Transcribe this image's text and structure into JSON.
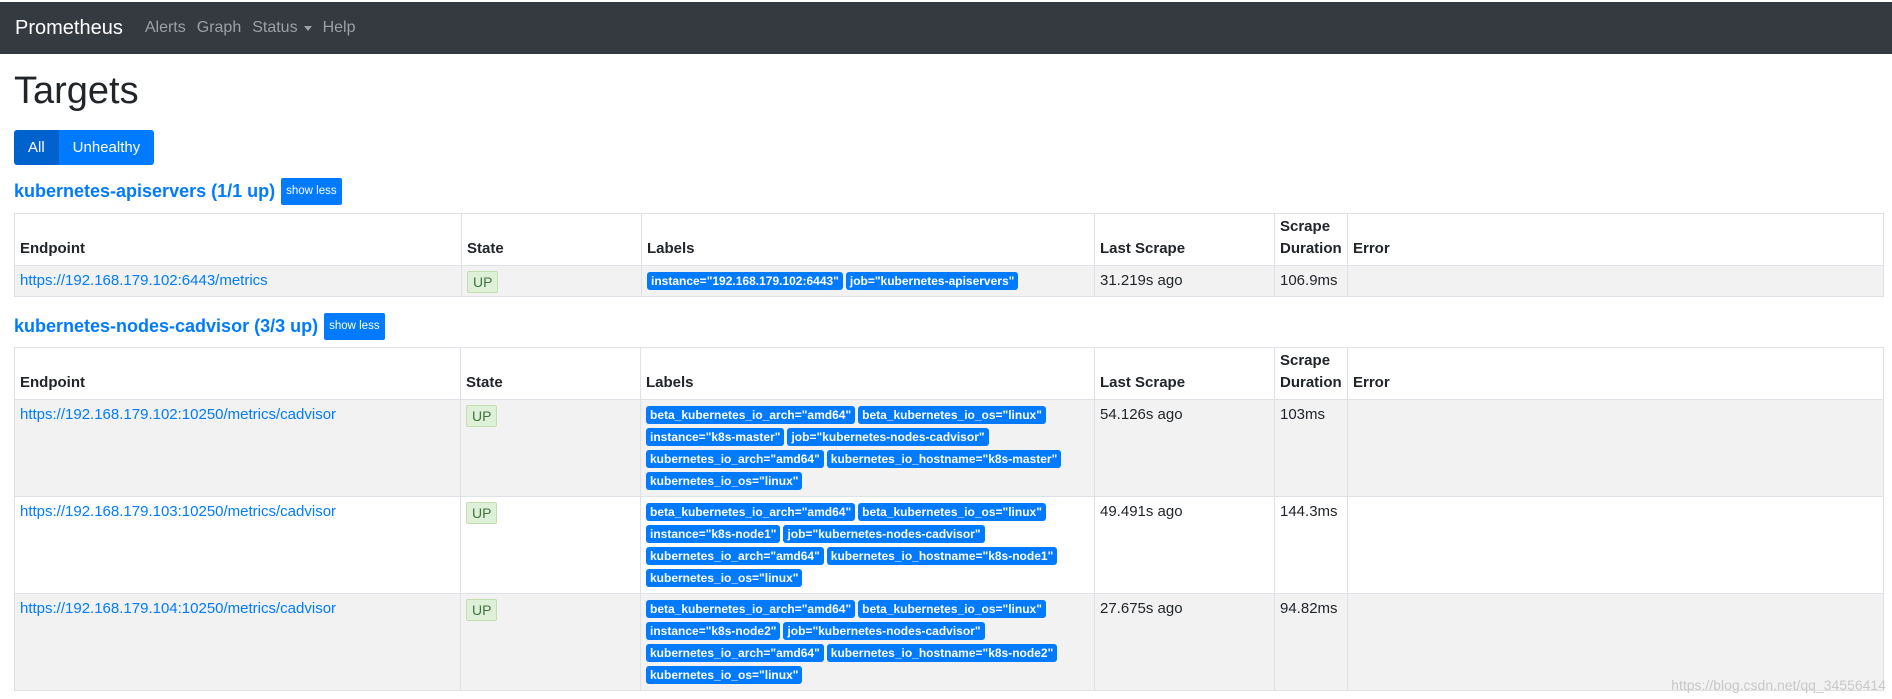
{
  "nav": {
    "brand": "Prometheus",
    "items": [
      "Alerts",
      "Graph",
      "Status",
      "Help"
    ]
  },
  "page": {
    "title": "Targets",
    "filters": [
      "All",
      "Unhealthy"
    ],
    "active_filter": "All"
  },
  "columns": [
    "Endpoint",
    "State",
    "Labels",
    "Last Scrape",
    "Scrape\nDuration",
    "Error"
  ],
  "groups": [
    {
      "title": "kubernetes-apiservers (1/1 up)",
      "toggle_label": "show less",
      "rows": [
        {
          "endpoint": "https://192.168.179.102:6443/metrics",
          "state": "UP",
          "labels": [
            "instance=\"192.168.179.102:6443\"",
            "job=\"kubernetes-apiservers\""
          ],
          "last_scrape": "31.219s ago",
          "scrape_duration": "106.9ms",
          "error": ""
        }
      ]
    },
    {
      "title": "kubernetes-nodes-cadvisor (3/3 up)",
      "toggle_label": "show less",
      "rows": [
        {
          "endpoint": "https://192.168.179.102:10250/metrics/cadvisor",
          "state": "UP",
          "labels": [
            "beta_kubernetes_io_arch=\"amd64\"",
            "beta_kubernetes_io_os=\"linux\"",
            "instance=\"k8s-master\"",
            "job=\"kubernetes-nodes-cadvisor\"",
            "kubernetes_io_arch=\"amd64\"",
            "kubernetes_io_hostname=\"k8s-master\"",
            "kubernetes_io_os=\"linux\""
          ],
          "last_scrape": "54.126s ago",
          "scrape_duration": "103ms",
          "error": ""
        },
        {
          "endpoint": "https://192.168.179.103:10250/metrics/cadvisor",
          "state": "UP",
          "labels": [
            "beta_kubernetes_io_arch=\"amd64\"",
            "beta_kubernetes_io_os=\"linux\"",
            "instance=\"k8s-node1\"",
            "job=\"kubernetes-nodes-cadvisor\"",
            "kubernetes_io_arch=\"amd64\"",
            "kubernetes_io_hostname=\"k8s-node1\"",
            "kubernetes_io_os=\"linux\""
          ],
          "last_scrape": "49.491s ago",
          "scrape_duration": "144.3ms",
          "error": ""
        },
        {
          "endpoint": "https://192.168.179.104:10250/metrics/cadvisor",
          "state": "UP",
          "labels": [
            "beta_kubernetes_io_arch=\"amd64\"",
            "beta_kubernetes_io_os=\"linux\"",
            "instance=\"k8s-node2\"",
            "job=\"kubernetes-nodes-cadvisor\"",
            "kubernetes_io_arch=\"amd64\"",
            "kubernetes_io_hostname=\"k8s-node2\"",
            "kubernetes_io_os=\"linux\""
          ],
          "last_scrape": "27.675s ago",
          "scrape_duration": "94.82ms",
          "error": ""
        }
      ]
    }
  ],
  "watermark": "https://blog.csdn.net/qq_34556414",
  "colors": {
    "navbar_bg": "#343a40",
    "accent": "#007bff",
    "up_badge_bg": "#dff0d8",
    "up_badge_text": "#3c763d",
    "stripe": "#f2f2f2"
  }
}
